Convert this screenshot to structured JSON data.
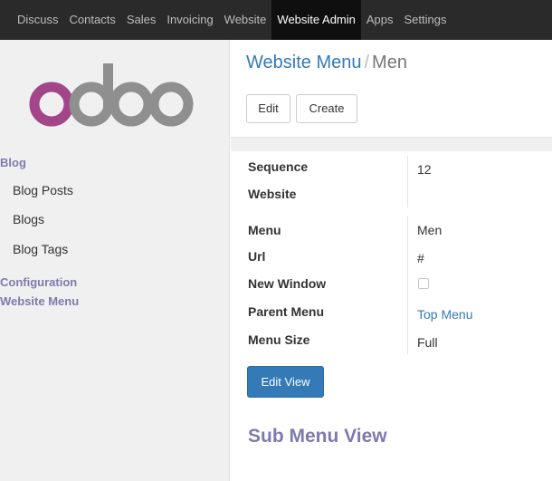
{
  "topbar": {
    "items": [
      "Discuss",
      "Contacts",
      "Sales",
      "Invoicing",
      "Website",
      "Website Admin",
      "Apps",
      "Settings"
    ],
    "active_item": "Website Admin"
  },
  "sidebar": {
    "logo_icon": "odoo-logo",
    "sections": [
      {
        "label": "Blog",
        "items": [
          "Blog Posts",
          "Blogs",
          "Blog Tags"
        ]
      },
      {
        "label": "Configuration",
        "items": []
      },
      {
        "label": "Website Menu",
        "items": []
      }
    ]
  },
  "breadcrumb": {
    "parent": "Website Menu",
    "separator": "/",
    "current": "Men"
  },
  "toolbar": {
    "edit_label": "Edit",
    "create_label": "Create"
  },
  "form": {
    "sequence": {
      "label": "Sequence",
      "value": "12"
    },
    "website": {
      "label": "Website",
      "value": ""
    },
    "menu": {
      "label": "Menu",
      "value": "Men"
    },
    "url": {
      "label": "Url",
      "value": "#"
    },
    "new_window": {
      "label": "New Window",
      "checked": false
    },
    "parent_menu": {
      "label": "Parent Menu",
      "value": "Top Menu"
    },
    "menu_size": {
      "label": "Menu Size",
      "value": "Full"
    }
  },
  "edit_view_label": "Edit View",
  "sub_menu_title": "Sub Menu View",
  "colors": {
    "topbar_bg": "#2a2a2a",
    "accent_purple": "#7c7bad",
    "link_blue": "#337ab7",
    "logo_purple": "#a24689"
  }
}
